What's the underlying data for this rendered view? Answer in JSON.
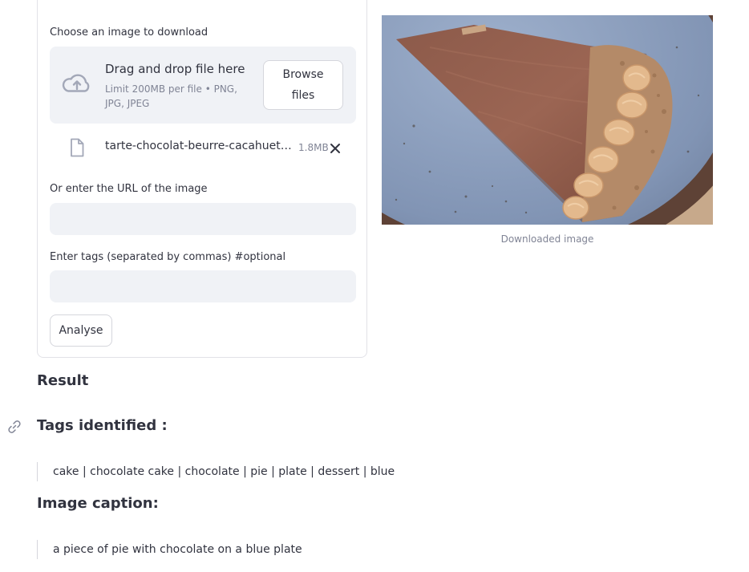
{
  "uploader": {
    "label": "Choose an image to download",
    "dropzone_title": "Drag and drop file here",
    "dropzone_limit": "Limit 200MB per file • PNG, JPG, JPEG",
    "browse_label": "Browse files",
    "file": {
      "name": "tarte-chocolat-beurre-cacahuete-recette.jpg",
      "size": "1.8MB"
    }
  },
  "url_field": {
    "label": "Or enter the URL of the image",
    "value": ""
  },
  "tags_field": {
    "label": "Enter tags (separated by commas) #optional",
    "value": ""
  },
  "analyse_label": "Analyse",
  "image": {
    "caption": "Downloaded image"
  },
  "result": {
    "heading": "Result",
    "tags_heading": "Tags identified :",
    "tags_text": "cake | chocolate cake | chocolate | pie | plate | dessert | blue",
    "caption_heading": "Image caption:",
    "caption_text": "a piece of pie with chocolate on a blue plate"
  },
  "colors": {
    "accent_bg": "#f0f2f6",
    "text": "#31333f",
    "muted": "#808495"
  }
}
